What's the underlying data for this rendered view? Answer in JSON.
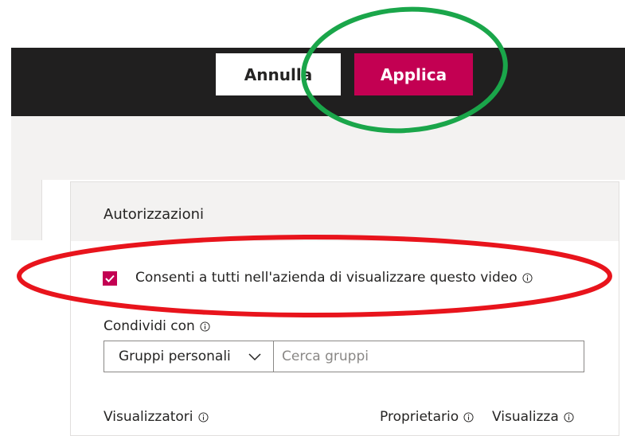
{
  "toolbar": {
    "cancel_label": "Annulla",
    "apply_label": "Applica",
    "apply_color": "#c30052",
    "bar_color": "#201f1f"
  },
  "permissions": {
    "title": "Autorizzazioni",
    "allow_all_label": "Consenti a tutti nell'azienda di visualizzare questo video",
    "allow_all_checked": true,
    "share_label": "Condividi con",
    "share_type_selected": "Gruppi personali",
    "search_placeholder": "Cerca gruppi",
    "search_value": "",
    "viewers_label": "Visualizzatori",
    "owner_label": "Proprietario",
    "view_label": "Visualizza"
  },
  "icons": {
    "info": "info-icon",
    "checkmark": "checkmark-icon",
    "chevron": "chevron-down-icon"
  },
  "annotations": {
    "green_ellipse_color": "#1aa64a",
    "red_ellipse_color": "#e8141c"
  }
}
